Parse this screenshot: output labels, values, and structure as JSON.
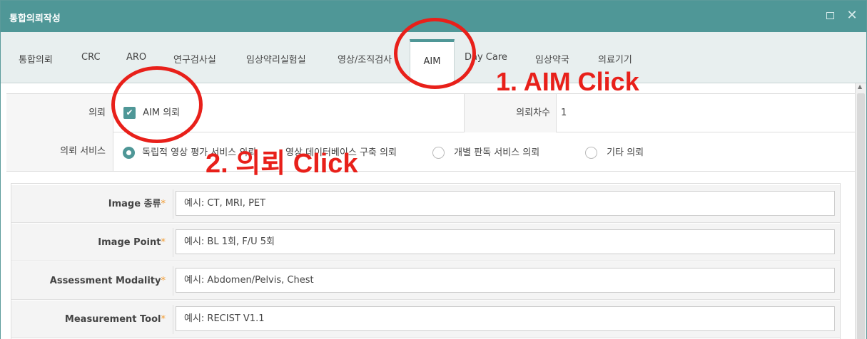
{
  "window": {
    "title": "통합의뢰작성"
  },
  "tabs": [
    {
      "label": "통합의뢰"
    },
    {
      "label": "CRC"
    },
    {
      "label": "ARO"
    },
    {
      "label": "연구검사실"
    },
    {
      "label": "임상약리실험실"
    },
    {
      "label": "영상/조직검사"
    },
    {
      "label": "AIM"
    },
    {
      "label": "Day Care"
    },
    {
      "label": "임상약국"
    },
    {
      "label": "의료기기"
    }
  ],
  "active_tab": "AIM",
  "request": {
    "label": "의뢰",
    "checkbox_label": "AIM 의뢰",
    "checked": true,
    "count_label": "의뢰차수",
    "count_value": "1"
  },
  "service": {
    "label": "의뢰 서비스",
    "options": [
      {
        "label": "독립적 영상 평가 서비스 의뢰",
        "selected": true
      },
      {
        "label": "영상 데이터베이스 구축 의뢰",
        "selected": false
      },
      {
        "label": "개별 판독 서비스 의뢰",
        "selected": false
      },
      {
        "label": "기타 의뢰",
        "selected": false
      }
    ]
  },
  "form": [
    {
      "label": "Image 종류",
      "placeholder": "예시: CT, MRI, PET"
    },
    {
      "label": "Image Point",
      "placeholder": "예시: BL 1회, F/U 5회"
    },
    {
      "label": "Assessment Modality",
      "placeholder": "예시: Abdomen/Pelvis, Chest"
    },
    {
      "label": "Measurement Tool",
      "placeholder": "예시: RECIST V1.1"
    }
  ],
  "required_mark": "*",
  "annotations": {
    "step1": "1. AIM Click",
    "step2": "2. 의뢰 Click",
    "color": "#e8201a"
  },
  "colors": {
    "accent": "#4f9797",
    "required": "#f29b30"
  }
}
